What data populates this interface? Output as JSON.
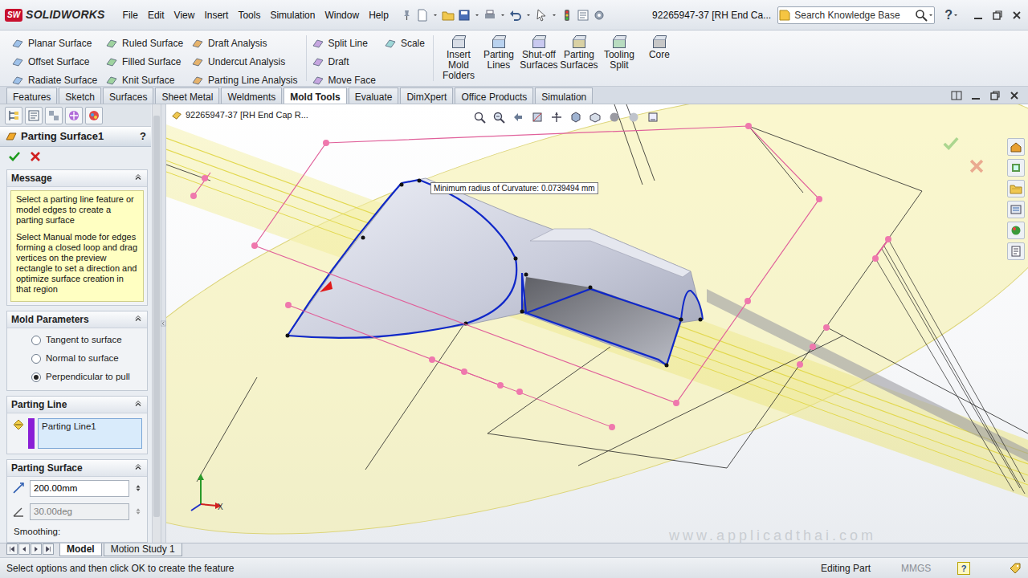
{
  "window": {
    "title": "92265947-37 [RH End Ca..."
  },
  "app": {
    "mark": "SW",
    "name": "SOLIDWORKS"
  },
  "menu": [
    "File",
    "Edit",
    "View",
    "Insert",
    "Tools",
    "Simulation",
    "Window",
    "Help"
  ],
  "search": {
    "placeholder": "Search Knowledge Base"
  },
  "help": "?",
  "ribbon": {
    "groups": [
      [
        "Planar Surface",
        "Offset Surface",
        "Radiate Surface"
      ],
      [
        "Ruled Surface",
        "Filled Surface",
        "Knit Surface"
      ],
      [
        "Draft Analysis",
        "Undercut Analysis",
        "Parting Line Analysis"
      ],
      [
        "Split Line",
        "Draft",
        "Move Face"
      ],
      [
        "Scale"
      ]
    ],
    "buttons": [
      {
        "lines": [
          "Insert",
          "Mold",
          "Folders"
        ]
      },
      {
        "lines": [
          "Parting",
          "Lines"
        ]
      },
      {
        "lines": [
          "Shut-off",
          "Surfaces"
        ]
      },
      {
        "lines": [
          "Parting",
          "Surfaces"
        ]
      },
      {
        "lines": [
          "Tooling",
          "Split"
        ]
      },
      {
        "lines": [
          "Core"
        ]
      }
    ]
  },
  "command_tabs": [
    {
      "label": "Features",
      "selected": false
    },
    {
      "label": "Sketch",
      "selected": false
    },
    {
      "label": "Surfaces",
      "selected": false
    },
    {
      "label": "Sheet Metal",
      "selected": false
    },
    {
      "label": "Weldments",
      "selected": false
    },
    {
      "label": "Mold Tools",
      "selected": true
    },
    {
      "label": "Evaluate",
      "selected": false
    },
    {
      "label": "DimXpert",
      "selected": false
    },
    {
      "label": "Office Products",
      "selected": false
    },
    {
      "label": "Simulation",
      "selected": false
    }
  ],
  "property_manager": {
    "title": "Parting Surface1",
    "help": "?",
    "message": {
      "title": "Message",
      "paragraphs": [
        "Select a parting line feature or model edges to create a parting surface",
        "Select Manual mode for edges forming a closed loop and drag vertices on the preview rectangle to set a direction and optimize surface creation in that region"
      ]
    },
    "mold_parameters": {
      "title": "Mold Parameters",
      "options": [
        {
          "label": "Tangent to surface",
          "selected": false
        },
        {
          "label": "Normal to surface",
          "selected": false
        },
        {
          "label": "Perpendicular to pull",
          "selected": true
        }
      ]
    },
    "parting_line": {
      "title": "Parting Line",
      "items": [
        "Parting Line1"
      ]
    },
    "parting_surface": {
      "title": "Parting Surface",
      "distance": "200.00mm",
      "angle": {
        "value": "30.00deg",
        "disabled": true
      },
      "smoothing": "Smoothing:"
    }
  },
  "viewport": {
    "tree_label": "92265947-37 [RH End Cap R...",
    "tooltip": "Minimum radius of Curvature: 0.0739494 mm",
    "watermark": "www.applicadthai.com",
    "axis_label": "X"
  },
  "bottom_tabs": [
    {
      "label": "Model",
      "selected": true
    },
    {
      "label": "Motion Study 1",
      "selected": false
    }
  ],
  "status_bar": {
    "message": "Select options and then click OK to create the feature",
    "mode": "Editing Part",
    "units": "MMGS",
    "help": "?"
  }
}
